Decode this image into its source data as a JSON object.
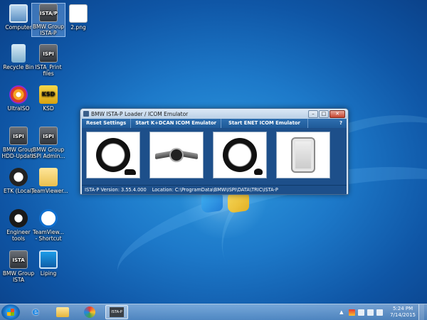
{
  "desktop": {
    "icons": [
      {
        "label": "Computer"
      },
      {
        "label": "BMW Group ISTA-P"
      },
      {
        "label": "2.png"
      },
      {
        "label": "Recycle Bin"
      },
      {
        "label": "ISTA_Print files"
      },
      {
        "label": "UltraISO"
      },
      {
        "label": "KSD"
      },
      {
        "label": "BMW Group HDD-Update"
      },
      {
        "label": "BMW Group ISPI Admin..."
      },
      {
        "label": "ETK (Local)"
      },
      {
        "label": "TeamViewer..."
      },
      {
        "label": "Engineer tools"
      },
      {
        "label": "TeamView... - Shortcut"
      },
      {
        "label": "BMW Group ISTA"
      },
      {
        "label": "Liping"
      }
    ]
  },
  "window": {
    "title": "BMW ISTA-P Loader / ICOM Emulator",
    "menu": {
      "reset": "Reset Settings",
      "kdcan": "Start K+DCAN ICOM Emulator",
      "enet": "Start ENET ICOM Emulator",
      "help": "?"
    },
    "status": {
      "version": "ISTA-P Version: 3.55.4.000",
      "location": "Location: C:\\ProgramData\\BMW\\ISPI\\DATA\\TRIC\\ISTA-P"
    }
  },
  "taskbar": {
    "ista_label": "ISTA-P",
    "time": "5:24 PM",
    "date": "7/14/2015"
  }
}
